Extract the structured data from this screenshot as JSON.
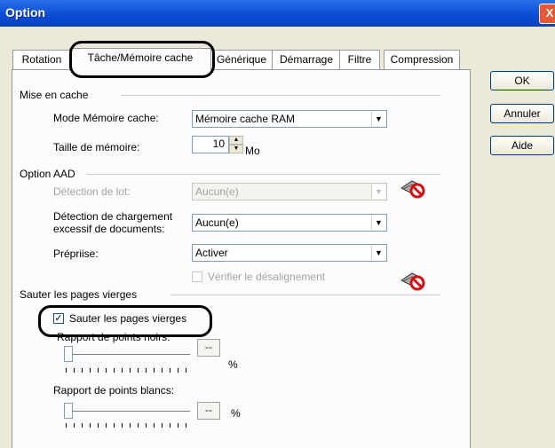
{
  "window": {
    "title": "Option",
    "close": "X"
  },
  "tabs": [
    "Rotation",
    "Tâche/Mémoire cache",
    "Générique",
    "Démarrage",
    "Filtre",
    "Compression"
  ],
  "buttons": {
    "ok": "OK",
    "cancel": "Annuler",
    "help": "Aide"
  },
  "cache": {
    "group": "Mise en cache",
    "mode_label": "Mode Mémoire cache:",
    "mode_value": "Mémoire cache RAM",
    "size_label": "Taille de mémoire:",
    "size_value": "10",
    "size_unit": "Mo"
  },
  "aad": {
    "group": "Option AAD",
    "batch_label": "Détection de lot:",
    "batch_value": "Aucun(e)",
    "overload_label_1": "Détection de chargement",
    "overload_label_2": "excessif de documents:",
    "overload_value": "Aucun(e)",
    "prepick_label": "Prépriise:",
    "prepick_value": "Activer",
    "skew_label": "Vérifier le désalignement"
  },
  "blank": {
    "group": "Sauter les pages vierges",
    "checkbox_label": "Sauter les pages vierges",
    "checked": true,
    "black_label": "Rapport de points noirs:",
    "black_value": "--",
    "white_label": "Rapport de points blancs:",
    "white_value": "--",
    "percent": "%"
  }
}
